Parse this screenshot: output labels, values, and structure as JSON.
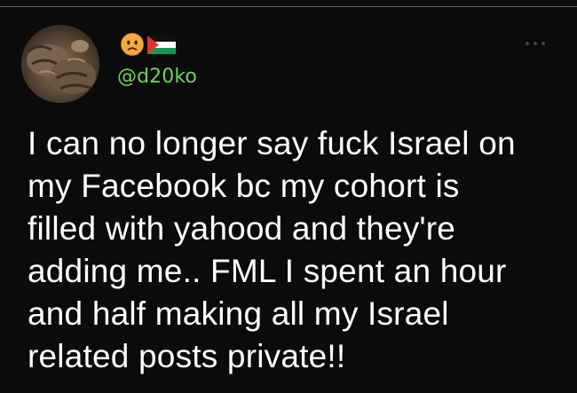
{
  "author": {
    "handle": "@d20ko",
    "avatar_icon": "cat-photo-avatar",
    "badges": [
      "frowning-face-emoji",
      "palestine-flag-icon"
    ]
  },
  "tweet": {
    "text": "I can no longer say fuck Israel on\nmy Facebook bc my cohort is\nfilled with yahood and they're\nadding me.. FML I spent an hour\nand half making all my Israel\nrelated posts private!!"
  },
  "colors": {
    "background": "#0b0b0b",
    "handle": "#6bd45a",
    "text": "#ffffff"
  }
}
